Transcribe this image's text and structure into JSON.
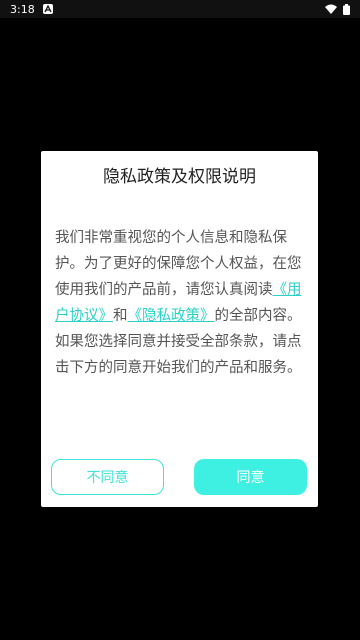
{
  "status_bar": {
    "time": "3:18",
    "notification_icon": "a-letter-icon",
    "wifi_icon": "wifi-icon",
    "battery_icon": "battery-icon"
  },
  "dialog": {
    "title": "隐私政策及权限说明",
    "body_part1": "我们非常重视您的个人信息和隐私保护。为了更好的保障您个人权益，在您使用我们的产品前，请您认真阅读",
    "user_agreement_link": "《用户协议》",
    "conjunction": "和",
    "privacy_policy_link": "《隐私政策》",
    "body_part2": "的全部内容。",
    "body_part3": "如果您选择同意并接受全部条款，请点击下方的同意开始我们的产品和服务。",
    "decline_label": "不同意",
    "agree_label": "同意"
  },
  "colors": {
    "accent": "#3ef0e2",
    "link": "#2ad1c9",
    "background": "#000000"
  }
}
